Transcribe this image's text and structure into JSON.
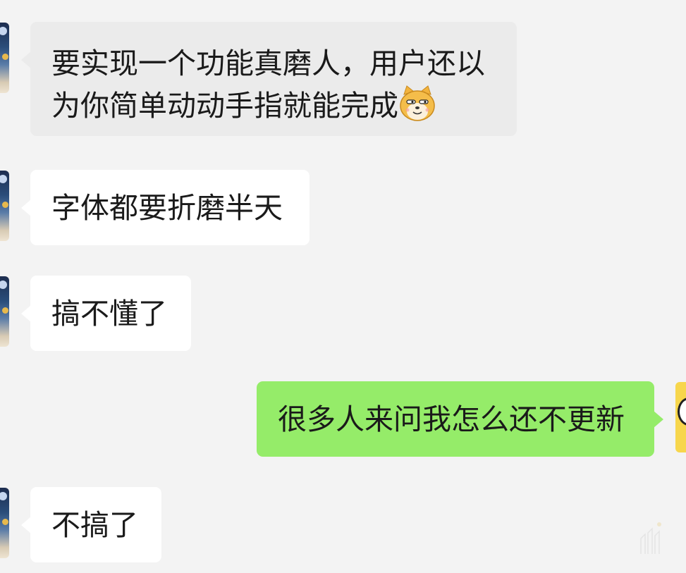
{
  "messages": [
    {
      "side": "left",
      "lines": [
        "要实现一个功能真磨人，用户还以",
        "为你简单动动手指就能完成"
      ],
      "emoji": "doge-emoji"
    },
    {
      "side": "left",
      "text": "字体都要折磨半天"
    },
    {
      "side": "left",
      "text": "搞不懂了"
    },
    {
      "side": "right",
      "text": "很多人来问我怎么还不更新"
    },
    {
      "side": "left",
      "text": "不搞了"
    }
  ],
  "colors": {
    "background": "#f3f3f3",
    "incoming_bubble": "#ffffff",
    "incoming_bubble_highlight": "#ebebeb",
    "outgoing_bubble": "#95ec69",
    "text": "#1a1a1a"
  }
}
